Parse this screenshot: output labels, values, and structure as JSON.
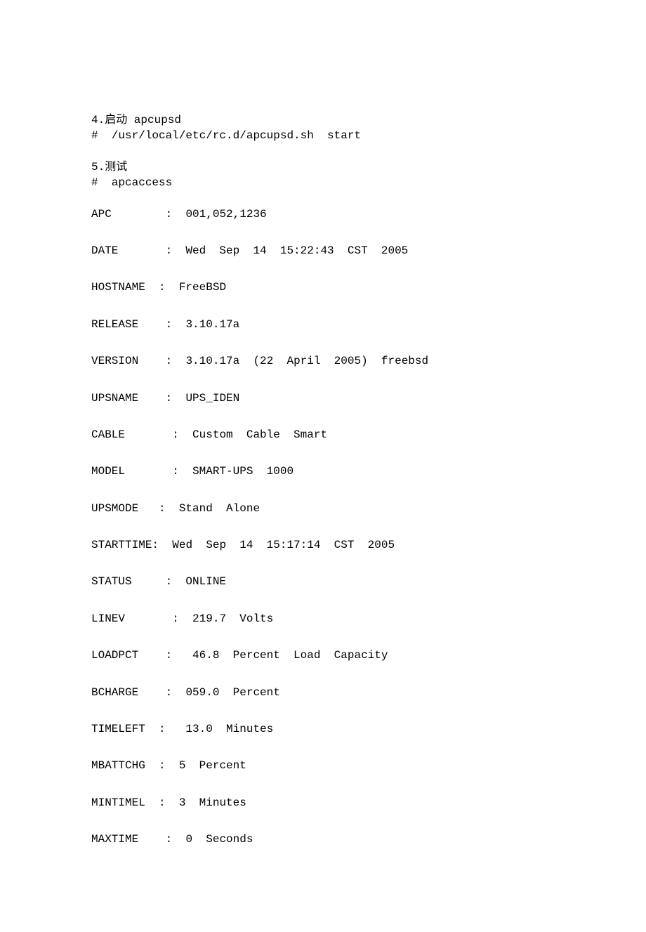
{
  "section4": {
    "title": "4.启动 apcupsd",
    "cmd": "#  /usr/local/etc/rc.d/apcupsd.sh  start"
  },
  "section5": {
    "title": "5.测试",
    "cmd": "#  apcaccess"
  },
  "rows": [
    {
      "k": "APC",
      "sep": "        :  ",
      "v": "001,052,1236"
    },
    {
      "k": "DATE",
      "sep": "       :  ",
      "v": "Wed  Sep  14  15:22:43  CST  2005"
    },
    {
      "k": "HOSTNAME",
      "sep": "  :  ",
      "v": "FreeBSD"
    },
    {
      "k": "RELEASE",
      "sep": "    :  ",
      "v": "3.10.17a"
    },
    {
      "k": "VERSION",
      "sep": "    :  ",
      "v": "3.10.17a  (22  April  2005)  freebsd"
    },
    {
      "k": "UPSNAME",
      "sep": "    :  ",
      "v": "UPS_IDEN"
    },
    {
      "k": "CABLE",
      "sep": "       :  ",
      "v": "Custom  Cable  Smart"
    },
    {
      "k": "MODEL",
      "sep": "       :  ",
      "v": "SMART-UPS  1000"
    },
    {
      "k": "UPSMODE",
      "sep": "   :  ",
      "v": "Stand  Alone"
    },
    {
      "k": "STARTTIME",
      "sep": ":  ",
      "v": "Wed  Sep  14  15:17:14  CST  2005"
    },
    {
      "k": "STATUS",
      "sep": "     :  ",
      "v": "ONLINE"
    },
    {
      "k": "LINEV",
      "sep": "       :  ",
      "v": "219.7  Volts"
    },
    {
      "k": "LOADPCT",
      "sep": "    :   ",
      "v": "46.8  Percent  Load  Capacity"
    },
    {
      "k": "BCHARGE",
      "sep": "    :  ",
      "v": "059.0  Percent"
    },
    {
      "k": "TIMELEFT",
      "sep": "  :   ",
      "v": "13.0  Minutes"
    },
    {
      "k": "MBATTCHG",
      "sep": "  :  ",
      "v": "5  Percent"
    },
    {
      "k": "MINTIMEL",
      "sep": "  :  ",
      "v": "3  Minutes"
    },
    {
      "k": "MAXTIME",
      "sep": "    :  ",
      "v": "0  Seconds"
    }
  ]
}
